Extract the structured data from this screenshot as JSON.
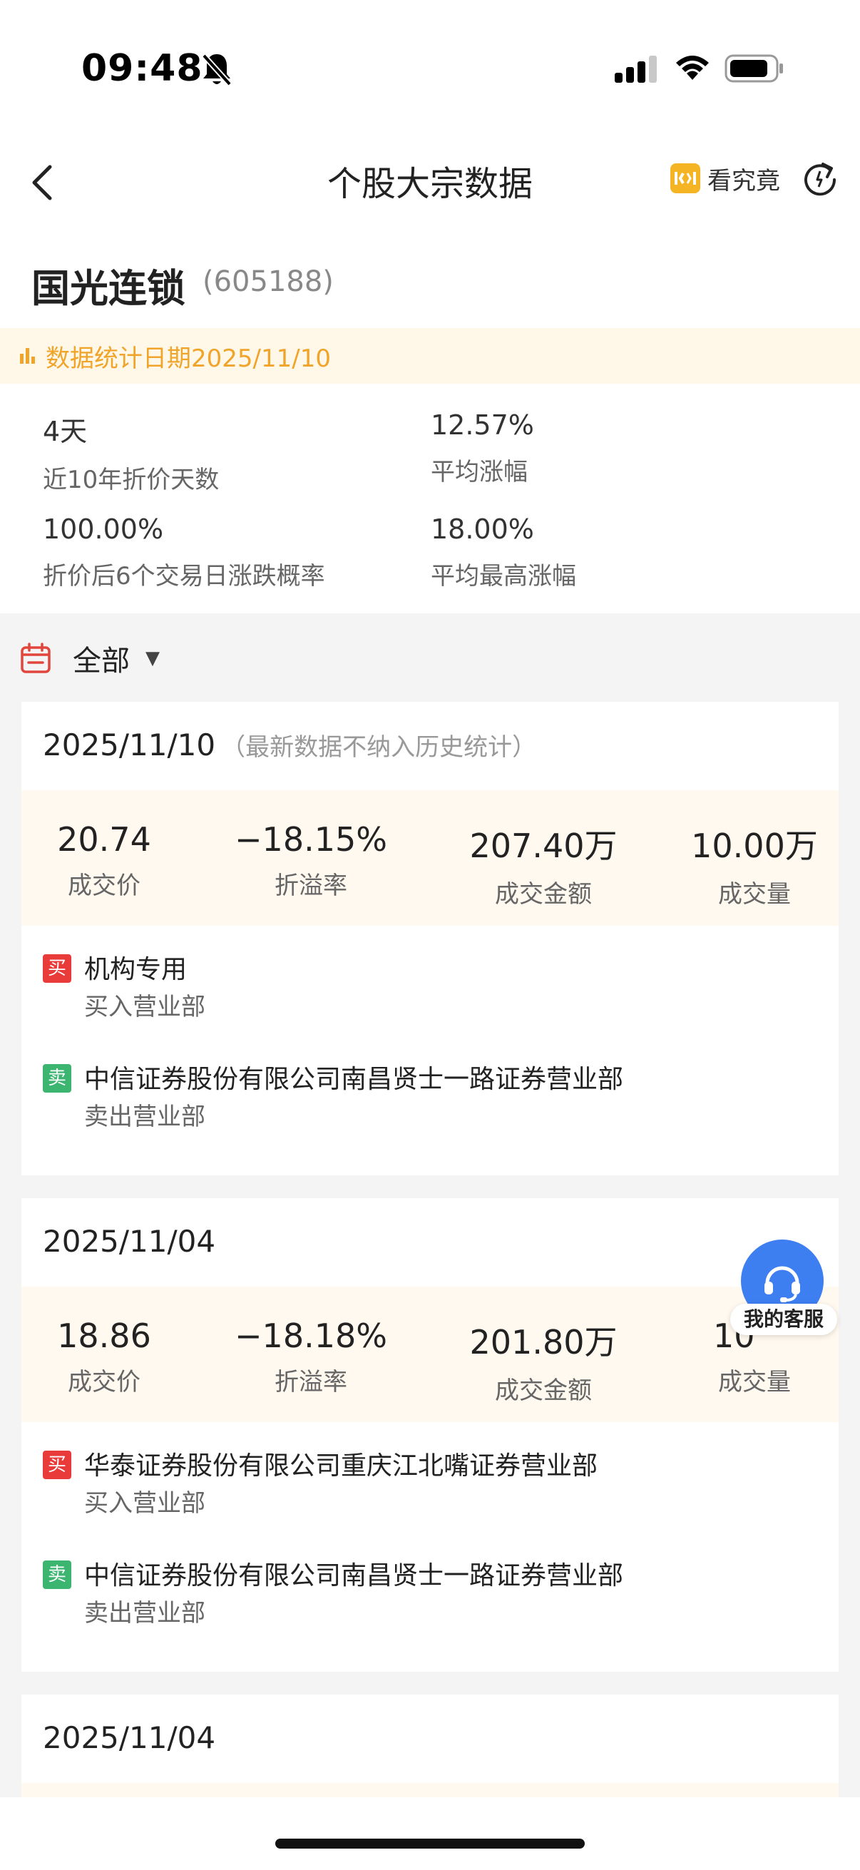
{
  "status_bar": {
    "time": "09:48"
  },
  "header": {
    "title": "个股大宗数据",
    "kanjiujing_label": "看究竟"
  },
  "stock": {
    "name": "国光连锁",
    "code": "(605188)"
  },
  "stat_date": "数据统计日期2025/11/10",
  "stats": [
    {
      "value": "4天",
      "label": "近10年折价天数"
    },
    {
      "value": "12.57%",
      "label": "平均涨幅"
    },
    {
      "value": "100.00%",
      "label": "折价后6个交易日涨跌概率"
    },
    {
      "value": "18.00%",
      "label": "平均最高涨幅"
    }
  ],
  "filter": {
    "label": "全部"
  },
  "records": [
    {
      "date": "2025/11/10",
      "note": "（最新数据不纳入历史统计）",
      "metrics": [
        {
          "value": "20.74",
          "label": "成交价"
        },
        {
          "value": "−18.15%",
          "label": "折溢率"
        },
        {
          "value": "207.40万",
          "label": "成交金额"
        },
        {
          "value": "10.00万",
          "label": "成交量"
        }
      ],
      "buy": {
        "tag": "买",
        "name": "机构专用",
        "role": "买入营业部"
      },
      "sell": {
        "tag": "卖",
        "name": "中信证券股份有限公司南昌贤士一路证券营业部",
        "role": "卖出营业部"
      }
    },
    {
      "date": "2025/11/04",
      "note": "",
      "metrics": [
        {
          "value": "18.86",
          "label": "成交价"
        },
        {
          "value": "−18.18%",
          "label": "折溢率"
        },
        {
          "value": "201.80万",
          "label": "成交金额"
        },
        {
          "value": "10",
          "label": "成交量"
        }
      ],
      "buy": {
        "tag": "买",
        "name": "华泰证券股份有限公司重庆江北嘴证券营业部",
        "role": "买入营业部"
      },
      "sell": {
        "tag": "卖",
        "name": "中信证券股份有限公司南昌贤士一路证券营业部",
        "role": "卖出营业部"
      }
    },
    {
      "date": "2025/11/04"
    }
  ],
  "customer_service": {
    "label": "我的客服"
  }
}
